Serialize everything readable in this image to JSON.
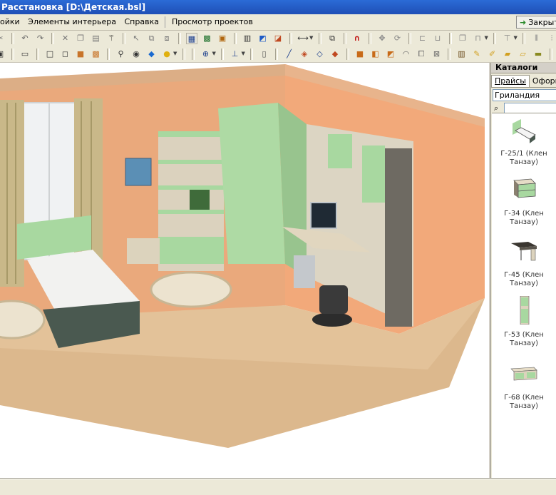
{
  "window": {
    "title": "Расстановка [D:\\Детская.bsl]"
  },
  "menu": [
    "ойки",
    "Элементы интерьера",
    "Справка",
    "Просмотр проектов"
  ],
  "close_project_label": "Закрыть",
  "panel": {
    "header": "Каталоги",
    "tabs": [
      "Прайсы",
      "Оформл"
    ],
    "catalog": "Гриландия"
  },
  "catalog_items": [
    {
      "label": "Г-25/1 (Клен Танзау)",
      "icon": "bed-icon"
    },
    {
      "label": "Г-34 (Клен Танзау)",
      "icon": "nightstand-icon"
    },
    {
      "label": "Г-45 (Клен Танзау)",
      "icon": "desk-icon"
    },
    {
      "label": "Г-53 (Клен Танзау)",
      "icon": "bookcase-icon"
    },
    {
      "label": "Г-68 (Клен Танзау)",
      "icon": "cabinet-icon"
    }
  ],
  "colors": {
    "wall": "#e8a878",
    "floor": "#e2c196",
    "furniture_green": "#a8d8a0",
    "furniture_frame": "#6e6a62"
  }
}
